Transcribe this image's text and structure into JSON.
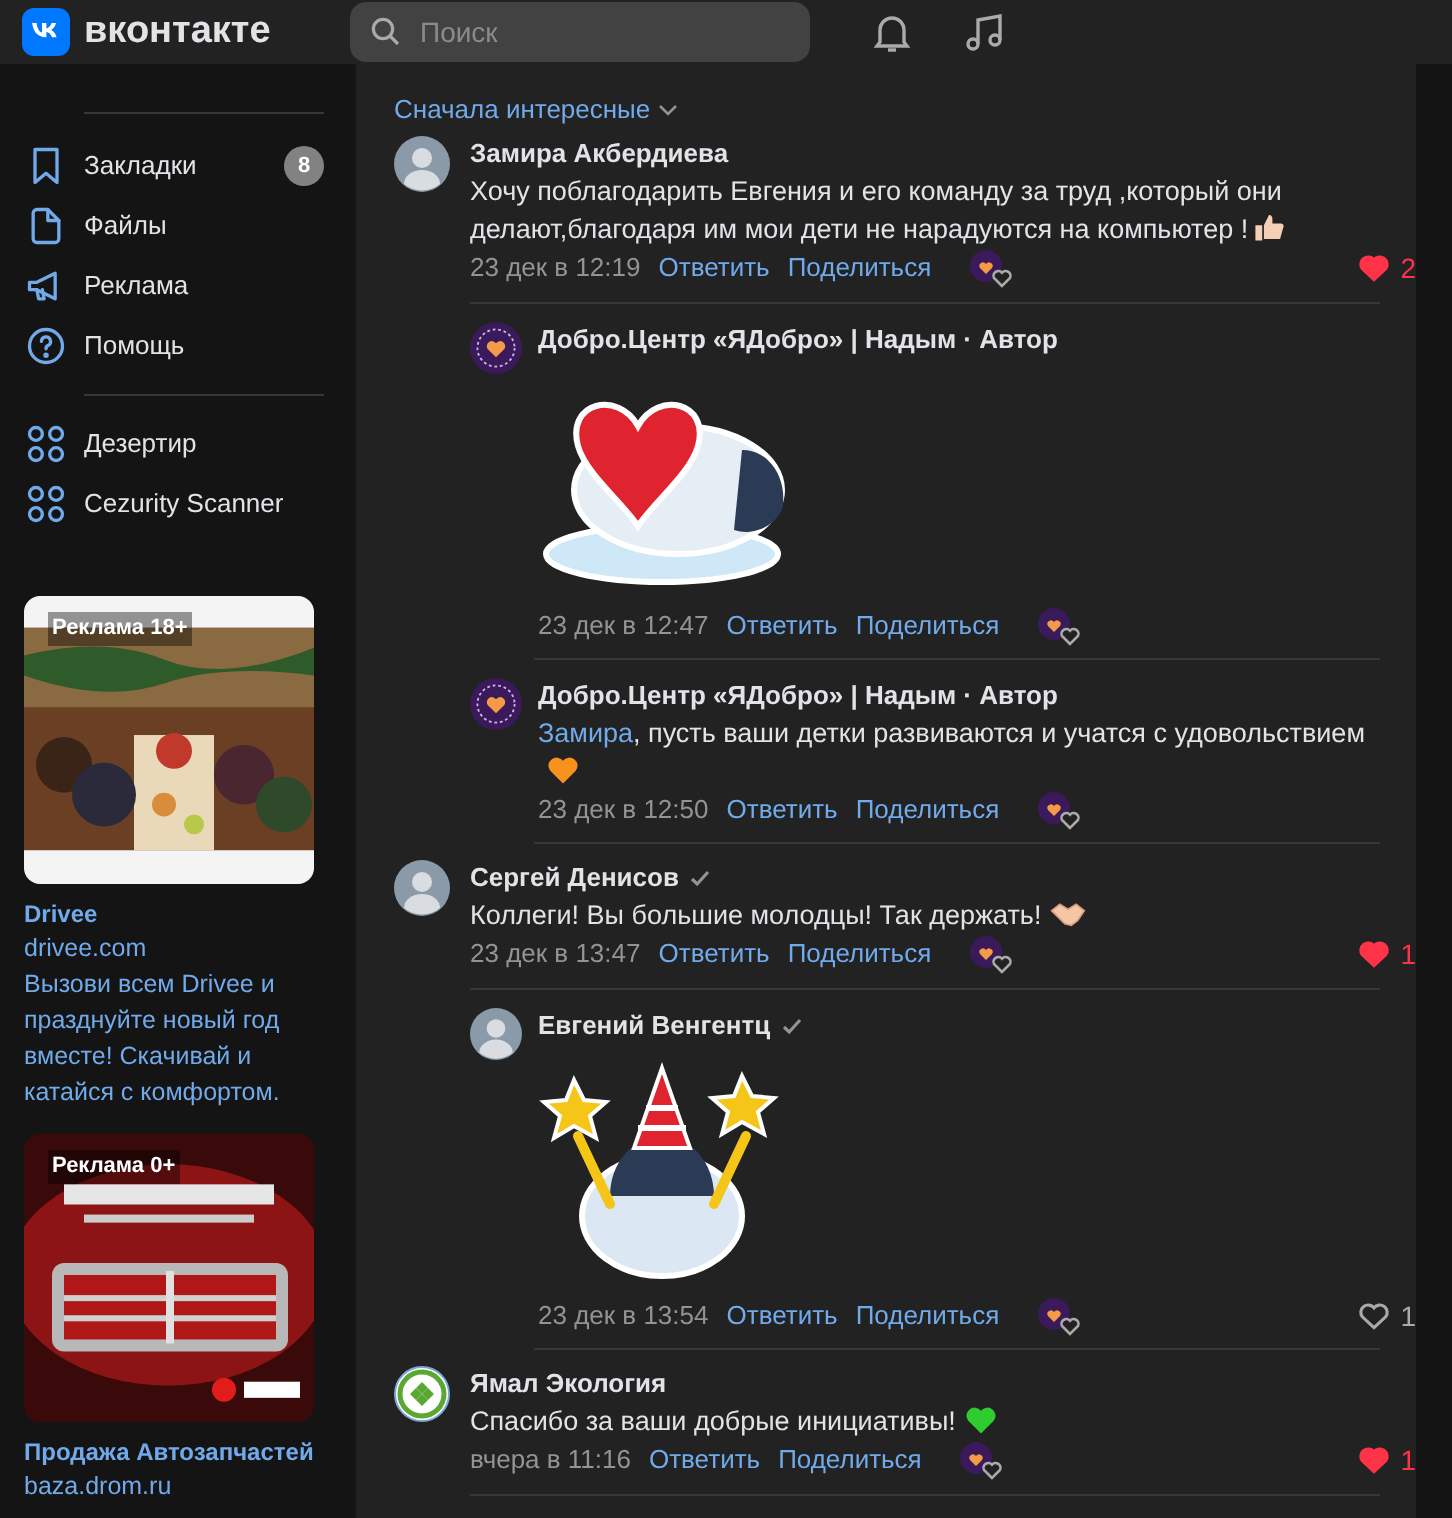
{
  "header": {
    "logo": "вконтакте",
    "search": {
      "placeholder": "Поиск"
    }
  },
  "sidebar": {
    "items": [
      {
        "label": "Закладки",
        "badge": "8"
      },
      {
        "label": "Файлы"
      },
      {
        "label": "Реклама"
      },
      {
        "label": "Помощь"
      }
    ],
    "apps": [
      {
        "label": "Дезертир"
      },
      {
        "label": "Cezurity Scanner"
      }
    ],
    "ads": [
      {
        "kind": "party",
        "tag": "Реклама 18+",
        "title": "Drivee",
        "domain": "drivee.com",
        "text": "Вызови всем Drivee и празднуйте новый год вместе! Скачивай и катайся с комфортом."
      },
      {
        "kind": "parts",
        "tag": "Реклама 0+",
        "title": "Продажа Автозапчастей",
        "domain": "baza.drom.ru"
      }
    ]
  },
  "feed": {
    "sort": "Сначала интересные",
    "comments": [
      {
        "author": "Замира Акбердиева",
        "verified": false,
        "kind": "text",
        "text": "Хочу поблагодарить Евгения и его команду за труд ,который они делают,благодаря им мои дети не нарадуются на компьютер !",
        "emoji": {
          "kind": "thumbs_up",
          "color": "#f5d0b5"
        },
        "time": "23 дек в 12:19",
        "reply": "Ответить",
        "share": "Поделиться",
        "likes": {
          "count": "2",
          "liked": true
        },
        "replies": [
          {
            "author": "Добро.Центр «ЯДобро» | Надым · Автор",
            "verified": false,
            "kind": "sticker",
            "time": "23 дек в 12:47",
            "reply": "Ответить",
            "share": "Поделиться"
          },
          {
            "author": "Добро.Центр «ЯДобро» | Надым · Автор",
            "verified": false,
            "kind": "text",
            "mention": "Замира",
            "text": ", пусть ваши детки развиваются и учатся с удовольствием",
            "emoji": {
              "kind": "heart",
              "color": "#f7921e"
            },
            "time": "23 дек в 12:50",
            "reply": "Ответить",
            "share": "Поделиться"
          }
        ]
      },
      {
        "author": "Сергей Денисов",
        "verified": true,
        "kind": "text",
        "text": "Коллеги! Вы большие молодцы! Так держать!",
        "emoji": {
          "kind": "handshake",
          "color": "#f5c6a5"
        },
        "time": "23 дек в 13:47",
        "reply": "Ответить",
        "share": "Поделиться",
        "likes": {
          "count": "1",
          "liked": true
        },
        "replies": [
          {
            "author": "Евгений Венгентц",
            "verified": true,
            "kind": "sticker",
            "time": "23 дек в 13:54",
            "reply": "Ответить",
            "share": "Поделиться",
            "likes": {
              "count": "1",
              "liked": false
            }
          }
        ]
      },
      {
        "author": "Ямал Экология",
        "verified": false,
        "kind": "text",
        "text": "Спасибо за ваши добрые инициативы!",
        "emoji": {
          "kind": "heart",
          "color": "#2ecc2e"
        },
        "time": "вчера в 11:16",
        "reply": "Ответить",
        "share": "Поделиться",
        "likes": {
          "count": "1",
          "liked": true
        }
      }
    ]
  }
}
